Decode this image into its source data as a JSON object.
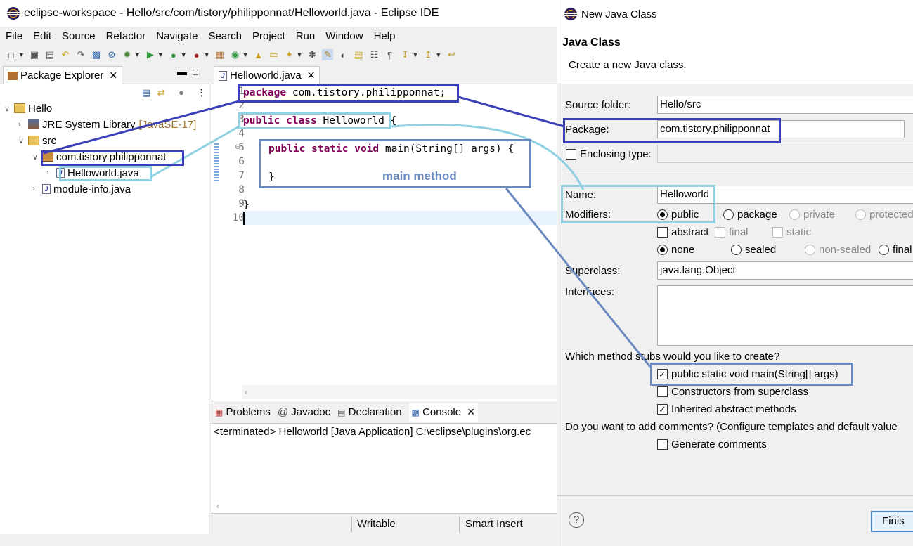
{
  "window": {
    "title": "eclipse-workspace - Hello/src/com/tistory/philipponnat/Helloworld.java - Eclipse IDE"
  },
  "menu": [
    "File",
    "Edit",
    "Source",
    "Refactor",
    "Navigate",
    "Search",
    "Project",
    "Run",
    "Window",
    "Help"
  ],
  "package_explorer": {
    "tab_label": "Package Explorer",
    "tree": {
      "project": "Hello",
      "jre": "JRE System Library",
      "jre_version": "[JavaSE-17]",
      "src": "src",
      "package": "com.tistory.philipponnat",
      "file": "Helloworld.java",
      "module": "module-info.java"
    }
  },
  "editor": {
    "tab_label": "Helloworld.java",
    "line_numbers": [
      "1",
      "2",
      "3",
      "4",
      "5",
      "6",
      "7",
      "8",
      "9",
      "10"
    ],
    "code": {
      "l1_kw": "package",
      "l1_rest": " com.tistory.philipponnat;",
      "l3_kw": "public class",
      "l3_rest": " Helloworld {",
      "l5_kw": "public static void",
      "l5_rest": " main(String[] args) {",
      "l7": "}",
      "l9": "}"
    },
    "annotation": "main method"
  },
  "console": {
    "tabs": [
      "Problems",
      "Javadoc",
      "Declaration",
      "Console"
    ],
    "output": "<terminated> Helloworld [Java Application] C:\\eclipse\\plugins\\org.ec"
  },
  "status_bar": {
    "writable": "Writable",
    "insert_mode": "Smart Insert"
  },
  "dialog": {
    "title": "New Java Class",
    "heading": "Java Class",
    "description": "Create a new Java class.",
    "source_folder_label": "Source folder:",
    "source_folder_value": "Hello/src",
    "package_label": "Package:",
    "package_value": "com.tistory.philipponnat",
    "enclosing_label": "Enclosing type:",
    "name_label": "Name:",
    "name_value": "Helloworld",
    "modifiers_label": "Modifiers:",
    "modifiers": {
      "public": "public",
      "package": "package",
      "private": "private",
      "protected": "protected",
      "abstract": "abstract",
      "final": "final",
      "static": "static",
      "none": "none",
      "sealed": "sealed",
      "non_sealed": "non-sealed",
      "final2": "final"
    },
    "superclass_label": "Superclass:",
    "superclass_value": "java.lang.Object",
    "interfaces_label": "Interfaces:",
    "stubs_question": "Which method stubs would you like to create?",
    "stub_main": "public static void main(String[] args)",
    "stub_constructors": "Constructors from superclass",
    "stub_inherited": "Inherited abstract methods",
    "comments_question": "Do you want to add comments? (Configure templates and default value",
    "generate_comments": "Generate comments",
    "help": "?",
    "finish": "Finis"
  },
  "colors": {
    "dark_highlight": "#3b3fb8",
    "light_highlight": "#8fd0e3",
    "steel_highlight": "#6a89be",
    "keyword": "#7f0055"
  }
}
